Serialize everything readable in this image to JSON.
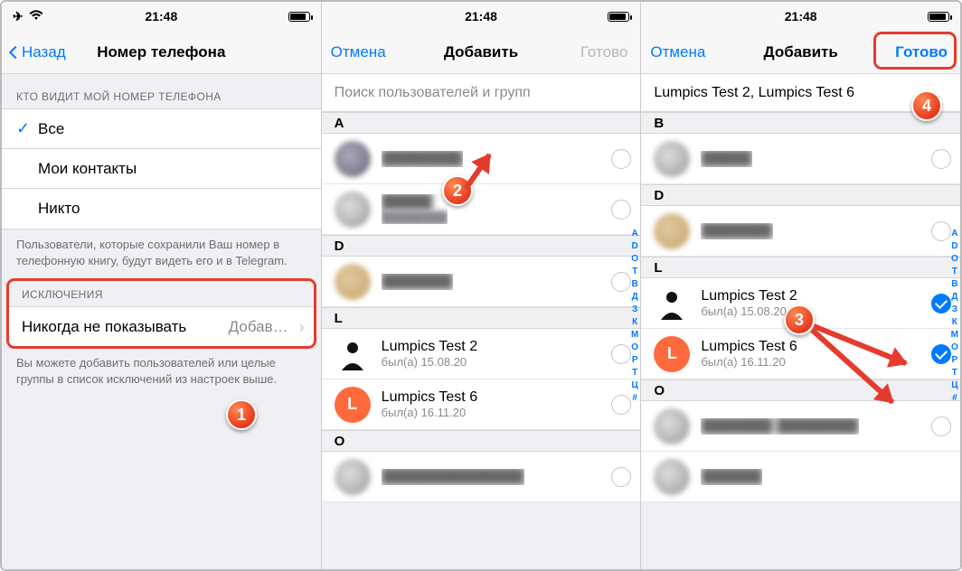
{
  "statusbar": {
    "time": "21:48"
  },
  "screen1": {
    "back": "Назад",
    "title": "Номер телефона",
    "section_visibility_header": "КТО ВИДИТ МОЙ НОМЕР ТЕЛЕФОНА",
    "visibility_options": [
      "Все",
      "Мои контакты",
      "Никто"
    ],
    "visibility_selected_index": 0,
    "visibility_note": "Пользователи, которые сохранили Ваш номер в телефонную книгу, будут видеть его и в Telegram.",
    "exceptions_header": "ИСКЛЮЧЕНИЯ",
    "never_show_label": "Никогда не показывать",
    "never_show_value": "Добав…",
    "exceptions_note": "Вы можете добавить пользователей или целые группы в список исключений из настроек выше."
  },
  "picker": {
    "cancel": "Отмена",
    "title": "Добавить",
    "done": "Готово",
    "search_placeholder": "Поиск пользователей и групп",
    "selected_summary": "Lumpics Test 2,  Lumpics Test 6",
    "sections_mid": {
      "A": [
        {
          "blur": true
        }
      ],
      "no_header_row": [
        {
          "blur": true
        }
      ],
      "D": [
        {
          "blur": true
        }
      ],
      "L": [
        {
          "name": "Lumpics Test 2",
          "sub": "был(а) 15.08.20",
          "avatar": "bw"
        },
        {
          "name": "Lumpics Test 6",
          "sub": "был(а) 16.11.20",
          "avatar": "orange",
          "initial": "L"
        }
      ],
      "O": [
        {
          "blur": true
        }
      ]
    },
    "sections_right": {
      "B": [
        {
          "blur": true
        }
      ],
      "D": [
        {
          "blur": true
        }
      ],
      "L": [
        {
          "name": "Lumpics Test 2",
          "sub": "был(а) 15.08.20",
          "avatar": "bw",
          "checked": true
        },
        {
          "name": "Lumpics Test 6",
          "sub": "был(а) 16.11.20",
          "avatar": "orange",
          "initial": "L",
          "checked": true
        }
      ],
      "O": [
        {
          "blur": true
        },
        {
          "blur": true
        }
      ]
    },
    "index_letters": [
      "A",
      "D",
      "O",
      "T",
      "В",
      "Д",
      "З",
      "К",
      "М",
      "О",
      "Р",
      "Т",
      "Ц",
      "#"
    ]
  },
  "annotations": {
    "labels": [
      "1",
      "2",
      "3",
      "4"
    ]
  }
}
